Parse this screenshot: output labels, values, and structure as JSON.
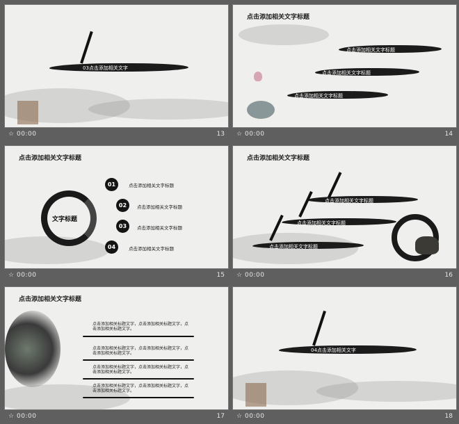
{
  "slides": [
    {
      "time": "00:00",
      "number": "13",
      "brush_text": "03点击添加相关文字"
    },
    {
      "time": "00:00",
      "number": "14",
      "title": "点击添加相关文字标题",
      "items": [
        "点击添加相关文字标题",
        "点击添加相关文字标题",
        "点击添加相关文字标题"
      ]
    },
    {
      "time": "00:00",
      "number": "15",
      "title": "点击添加相关文字标题",
      "circle_label": "文字标题",
      "items": [
        {
          "num": "01",
          "text": "点击添加相关文字标题"
        },
        {
          "num": "02",
          "text": "点击添加相关文字标题"
        },
        {
          "num": "03",
          "text": "点击添加相关文字标题"
        },
        {
          "num": "04",
          "text": "点击添加相关文字标题"
        }
      ]
    },
    {
      "time": "00:00",
      "number": "16",
      "title": "点击添加相关文字标题",
      "items": [
        "点击添加相关文字标题",
        "点击添加相关文字标题",
        "点击添加相关文字标题"
      ]
    },
    {
      "time": "00:00",
      "number": "17",
      "title": "点击添加相关文字标题",
      "paragraphs": [
        "点击添加相关标题文字，点击添加相关标题文字，点击添加相关标题文字。",
        "点击添加相关标题文字，点击添加相关标题文字，点击添加相关标题文字。",
        "点击添加相关标题文字，点击添加相关标题文字，点击添加相关标题文字。",
        "点击添加相关标题文字，点击添加相关标题文字，点击添加相关标题文字。"
      ]
    },
    {
      "time": "00:00",
      "number": "18",
      "brush_text": "04点击添加相关文字"
    }
  ],
  "footer_icon": "star-icon"
}
